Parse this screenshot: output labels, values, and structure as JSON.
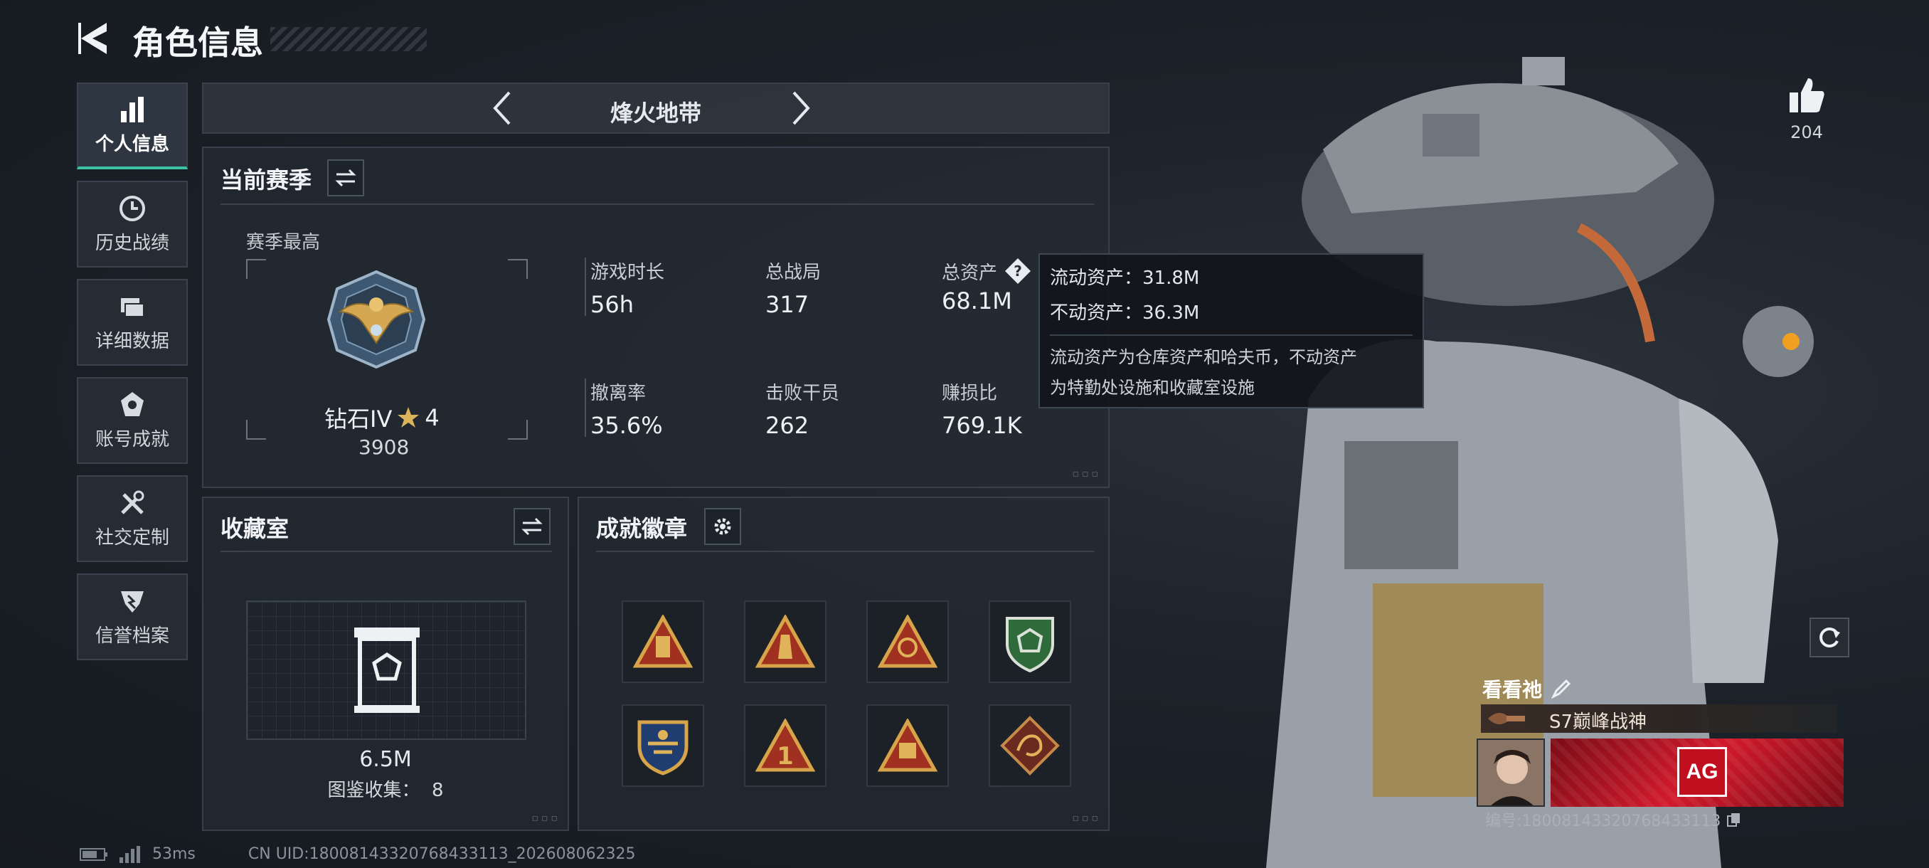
{
  "header": {
    "title": "角色信息"
  },
  "sidebar": {
    "items": [
      {
        "label": "个人信息",
        "icon": "bar-chart-icon",
        "active": true
      },
      {
        "label": "历史战绩",
        "icon": "clock-icon"
      },
      {
        "label": "详细数据",
        "icon": "folder-icon"
      },
      {
        "label": "账号成就",
        "icon": "medal-icon"
      },
      {
        "label": "社交定制",
        "icon": "tools-icon"
      },
      {
        "label": "信誉档案",
        "icon": "shield-icon"
      }
    ]
  },
  "mode_switch": {
    "title": "烽火地带"
  },
  "season": {
    "title": "当前赛季",
    "peak_label": "赛季最高",
    "rank_name": "钻石IV",
    "rank_stars": "4",
    "rank_score": "3908",
    "stats": [
      {
        "label": "游戏时长",
        "value": "56h"
      },
      {
        "label": "总战局",
        "value": "317"
      },
      {
        "label": "总资产",
        "value": "68.1M"
      },
      {
        "label": "撤离率",
        "value": "35.6%"
      },
      {
        "label": "击败干员",
        "value": "262"
      },
      {
        "label": "赚损比",
        "value": "769.1K"
      }
    ]
  },
  "tooltip": {
    "line1": "流动资产：31.8M",
    "line2": "不动资产：36.3M",
    "desc1": "流动资产为仓库资产和哈夫币，不动资产",
    "desc2": "为特勤处设施和收藏室设施"
  },
  "collection": {
    "title": "收藏室",
    "value": "6.5M",
    "catalog": "图鉴收集：  8"
  },
  "achievements": {
    "title": "成就徽章",
    "badges": [
      {
        "icon": "gold-triangle-badge-icon"
      },
      {
        "icon": "tower-triangle-badge-icon"
      },
      {
        "icon": "eye-triangle-badge-icon"
      },
      {
        "icon": "green-shield-badge-icon"
      },
      {
        "icon": "blue-crest-badge-icon"
      },
      {
        "icon": "number-one-badge-icon"
      },
      {
        "icon": "58-triangle-badge-icon"
      },
      {
        "icon": "dragon-diamond-badge-icon"
      }
    ]
  },
  "likes": {
    "count": "204"
  },
  "player_card": {
    "name": "看看祂",
    "title": "S7巅峰战神",
    "team": "AG",
    "id_text": "编号:18008143320768433113"
  },
  "footer": {
    "ping": "53ms",
    "uid": "CN UID:18008143320768433113_202608062325"
  },
  "colors": {
    "accent": "#39c3a3",
    "background": "#1c2229",
    "panel": "#242a32",
    "team_red": "#d21a2c"
  }
}
